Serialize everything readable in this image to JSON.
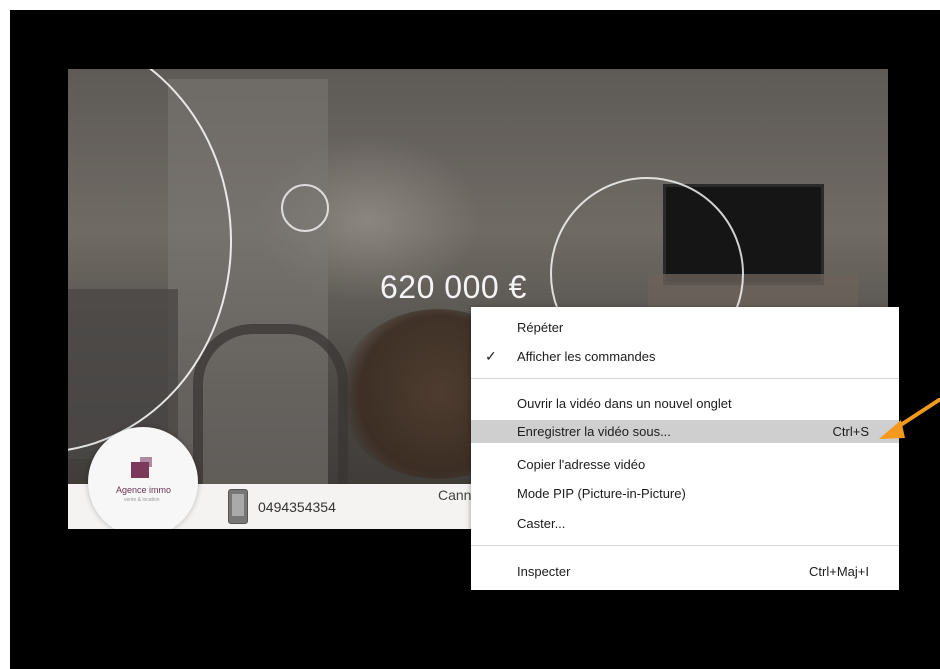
{
  "video": {
    "price": "620 000 €",
    "agency_logo_text": "Agence immo",
    "agency_logo_subtext": "vente & location",
    "phone_number": "0494354354",
    "city_partial": "Cann"
  },
  "context_menu": {
    "items": [
      {
        "label": "Répéter",
        "shortcut": "",
        "checked": false,
        "highlighted": false
      },
      {
        "label": "Afficher les commandes",
        "shortcut": "",
        "checked": true,
        "highlighted": false
      },
      {
        "label": "Ouvrir la vidéo dans un nouvel onglet",
        "shortcut": "",
        "checked": false,
        "highlighted": false
      },
      {
        "label": "Enregistrer la vidéo sous...",
        "shortcut": "Ctrl+S",
        "checked": false,
        "highlighted": true
      },
      {
        "label": "Copier l'adresse vidéo",
        "shortcut": "",
        "checked": false,
        "highlighted": false
      },
      {
        "label": "Mode PIP (Picture-in-Picture)",
        "shortcut": "",
        "checked": false,
        "highlighted": false
      },
      {
        "label": "Caster...",
        "shortcut": "",
        "checked": false,
        "highlighted": false
      },
      {
        "label": "Inspecter",
        "shortcut": "Ctrl+Maj+I",
        "checked": false,
        "highlighted": false
      }
    ],
    "check_glyph": "✓"
  },
  "colors": {
    "highlight": "#cfcfcf",
    "arrow": "#f39a1e",
    "logo_brand": "#7c3a5a"
  },
  "icons": {
    "check": "check-icon",
    "phone": "phone-icon",
    "annotation": "arrow-icon"
  }
}
